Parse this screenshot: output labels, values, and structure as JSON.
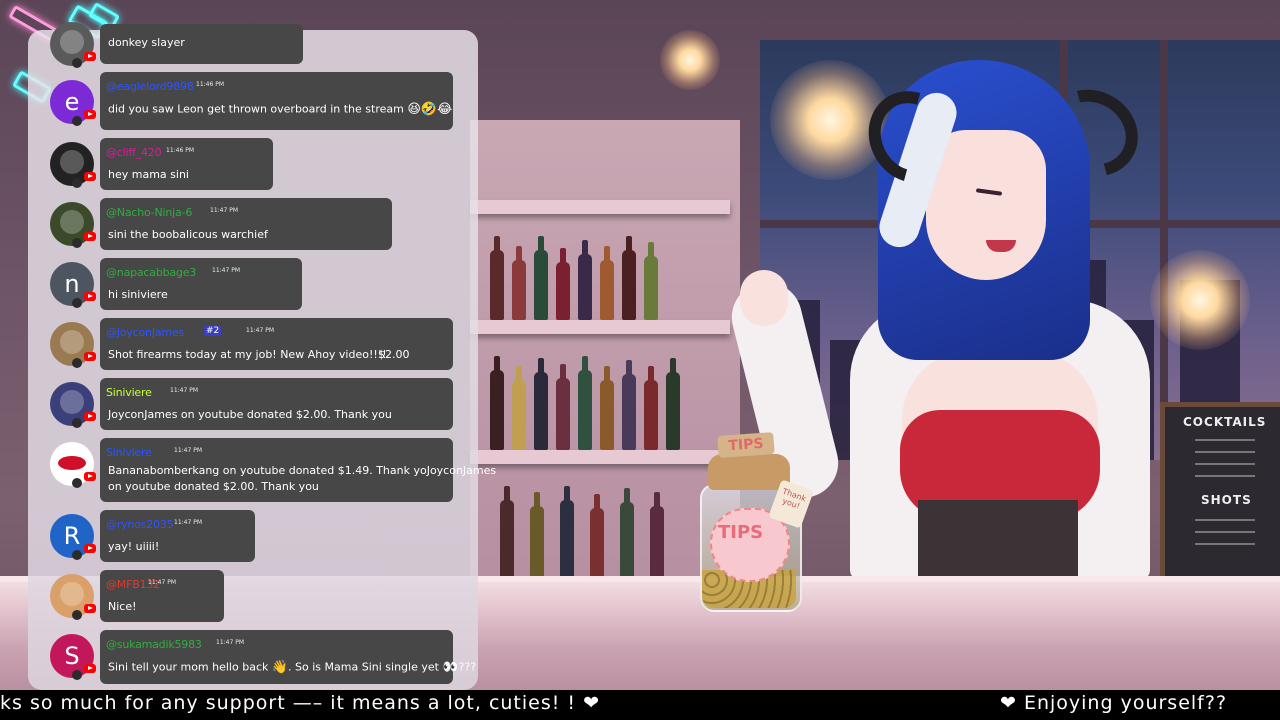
{
  "ticker": {
    "left_text": "ks so much for any support —– it means a lot, cuties! ! ❤",
    "right_text": "❤ Enjoying yourself??"
  },
  "scene": {
    "menu_board": {
      "title": "COCKTAILS",
      "subtitle": "SHOTS"
    },
    "tip_jar": {
      "tag_text": "TIPS",
      "jar_text": "TIPS",
      "thank_you": "Thank you!"
    }
  },
  "chat": {
    "messages": [
      {
        "avatar_letter": "",
        "avatar_kind": "image",
        "avatar_color": "#5a5a5a",
        "username": "",
        "name_color": "#ffffff",
        "timestamp": "",
        "text": "donkey slayer",
        "amount": ""
      },
      {
        "avatar_letter": "e",
        "avatar_kind": "letter",
        "avatar_color": "#7b2ad6",
        "username": "@eaglelord9898",
        "name_color": "#2d55ff",
        "timestamp": "11:46 PM",
        "text": "did you saw Leon get thrown overboard in the stream",
        "emojis": "😆🤣😂",
        "amount": ""
      },
      {
        "avatar_letter": "",
        "avatar_kind": "image",
        "avatar_color": "#222222",
        "username": "@cliff_420",
        "name_color": "#e0199a",
        "timestamp": "11:46 PM",
        "text": "hey mama sini",
        "amount": ""
      },
      {
        "avatar_letter": "",
        "avatar_kind": "image",
        "avatar_color": "#3a4a2a",
        "username": "@Nacho-Ninja-6",
        "name_color": "#2fae3f",
        "timestamp": "11:47 PM",
        "text": "sini the boobalicous warchief",
        "amount": ""
      },
      {
        "avatar_letter": "n",
        "avatar_kind": "letter",
        "avatar_color": "#4c5560",
        "username": "@napacabbage3",
        "name_color": "#2fae3f",
        "timestamp": "11:47 PM",
        "text": "hi siniviere",
        "amount": ""
      },
      {
        "avatar_letter": "",
        "avatar_kind": "image",
        "avatar_color": "#9a7a50",
        "username": "@JoyconJames",
        "name_color": "#2d55ff",
        "timestamp": "11:47 PM",
        "badge_text": "#2",
        "text": "Shot firearms today at my job! New Ahoy video!!!!",
        "amount": "$2.00"
      },
      {
        "avatar_letter": "",
        "avatar_kind": "image",
        "avatar_color": "#3b3f7a",
        "username": "Siniviere",
        "name_color": "#c8ff3a",
        "timestamp": "11:47 PM",
        "text": "JoyconJames on youtube donated $2.00. Thank you",
        "amount": ""
      },
      {
        "avatar_letter": "",
        "avatar_kind": "image",
        "avatar_color": "#ffffff",
        "username": "Siniviere",
        "name_color": "#2d55ff",
        "timestamp": "11:47 PM",
        "text": "Bananabomberkang on youtube donated $1.49. Thank yoJoyconJames",
        "text2": "on youtube donated $2.00. Thank you",
        "amount": ""
      },
      {
        "avatar_letter": "R",
        "avatar_kind": "letter",
        "avatar_color": "#1f64c6",
        "username": "@rynos2035",
        "name_color": "#2d55ff",
        "timestamp": "11:47 PM",
        "text": "yay! uiiii!",
        "amount": ""
      },
      {
        "avatar_letter": "",
        "avatar_kind": "image",
        "avatar_color": "#d9a06a",
        "username": "@MFB132",
        "name_color": "#e03a2a",
        "timestamp": "11:47 PM",
        "text": "Nice!",
        "amount": ""
      },
      {
        "avatar_letter": "S",
        "avatar_kind": "letter",
        "avatar_color": "#c2185b",
        "username": "@sukamadik5983",
        "name_color": "#2fae3f",
        "timestamp": "11:47 PM",
        "text": "Sini tell your mom hello back",
        "emojis": "👋",
        "text_after": ". So is Mama Sini single yet",
        "emojis2": "👀",
        "text_tail": "???",
        "amount": ""
      }
    ]
  },
  "colors": {
    "bubble": "#474747",
    "youtube_red": "#ff0000",
    "ticker_bg": "#000000"
  }
}
